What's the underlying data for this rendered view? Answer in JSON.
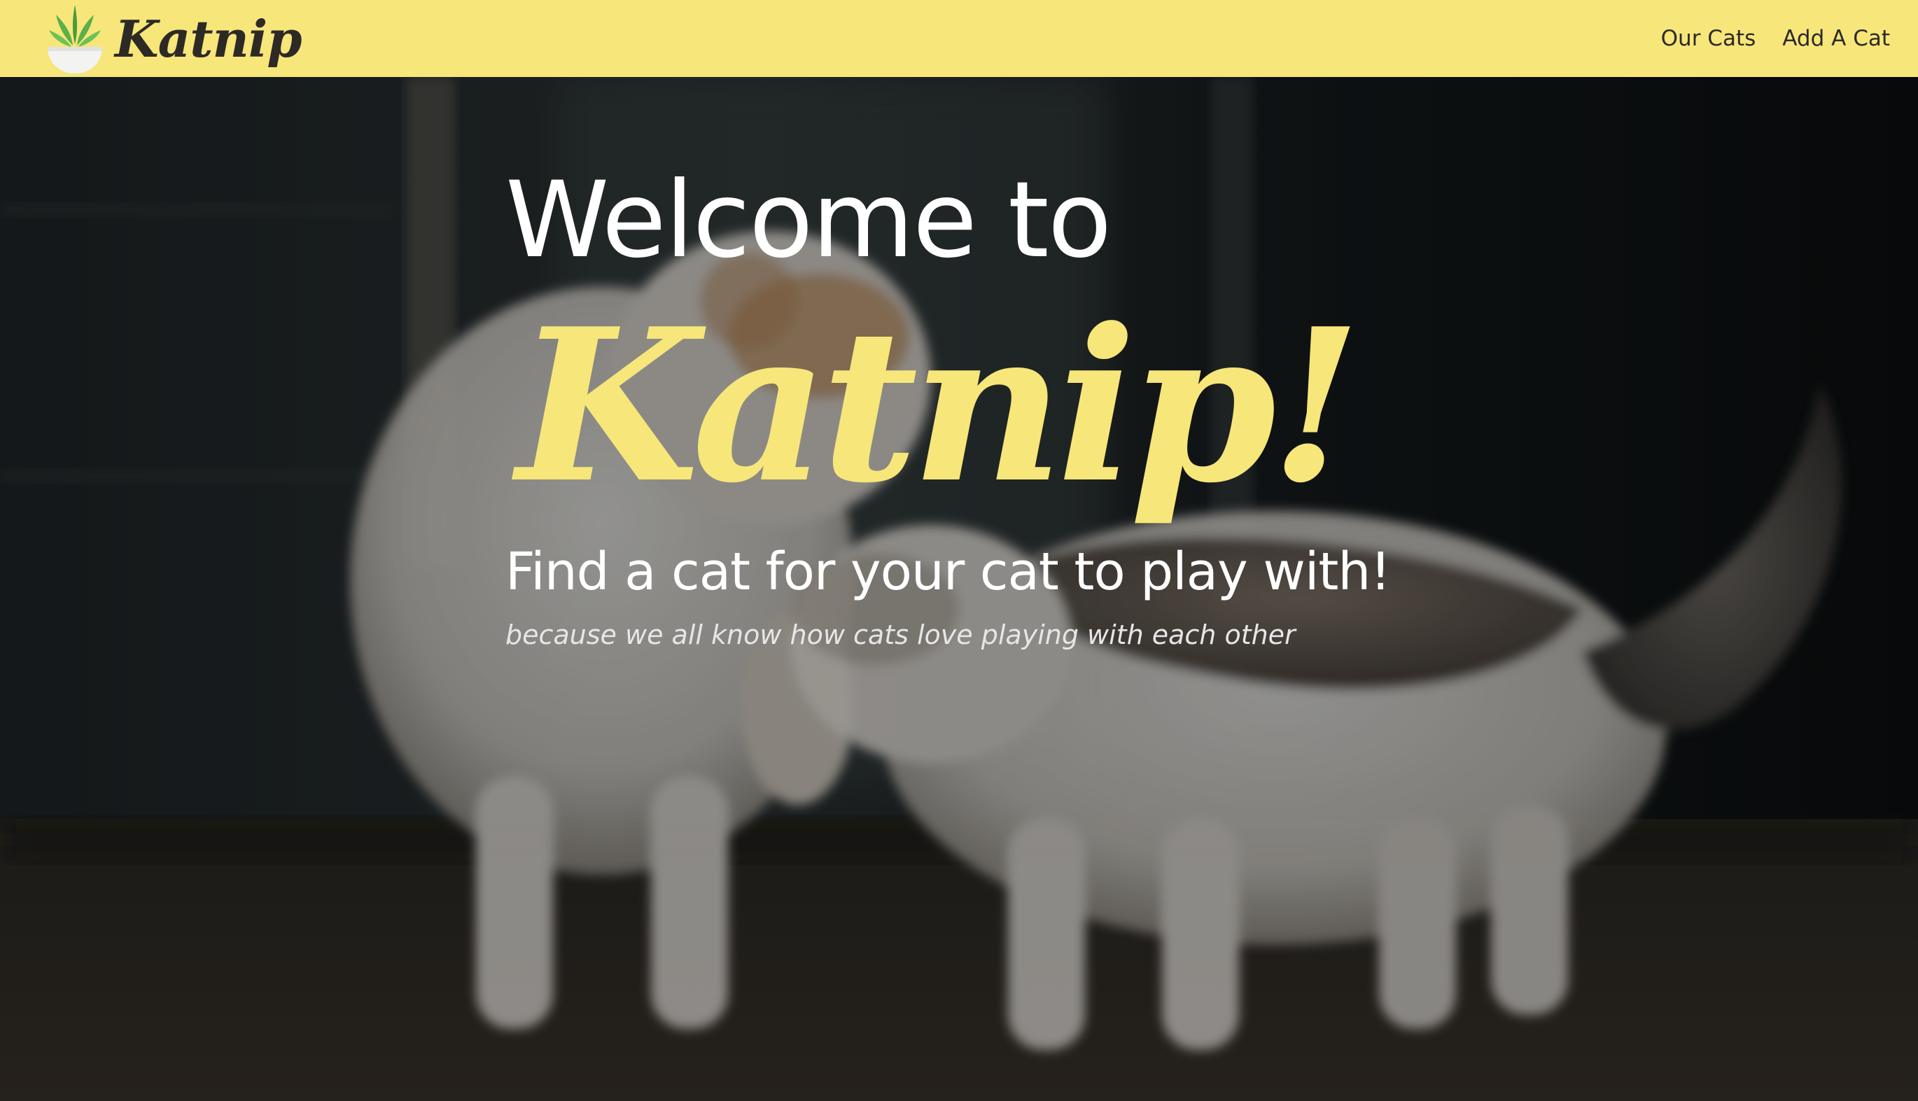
{
  "navbar": {
    "brand_name": "Katnip",
    "logo_icon": "potted-catnip-plant-icon",
    "links": [
      {
        "label": "Our Cats"
      },
      {
        "label": "Add A Cat"
      }
    ]
  },
  "hero": {
    "welcome": "Welcome to",
    "brand": "Katnip!",
    "tagline": "Find a cat for your cat to play with!",
    "subtagline": "because we all know how cats love playing with each other"
  },
  "colors": {
    "brand_yellow": "#f7e67a",
    "nav_text": "#2d2a26",
    "hero_text": "#ffffff"
  }
}
